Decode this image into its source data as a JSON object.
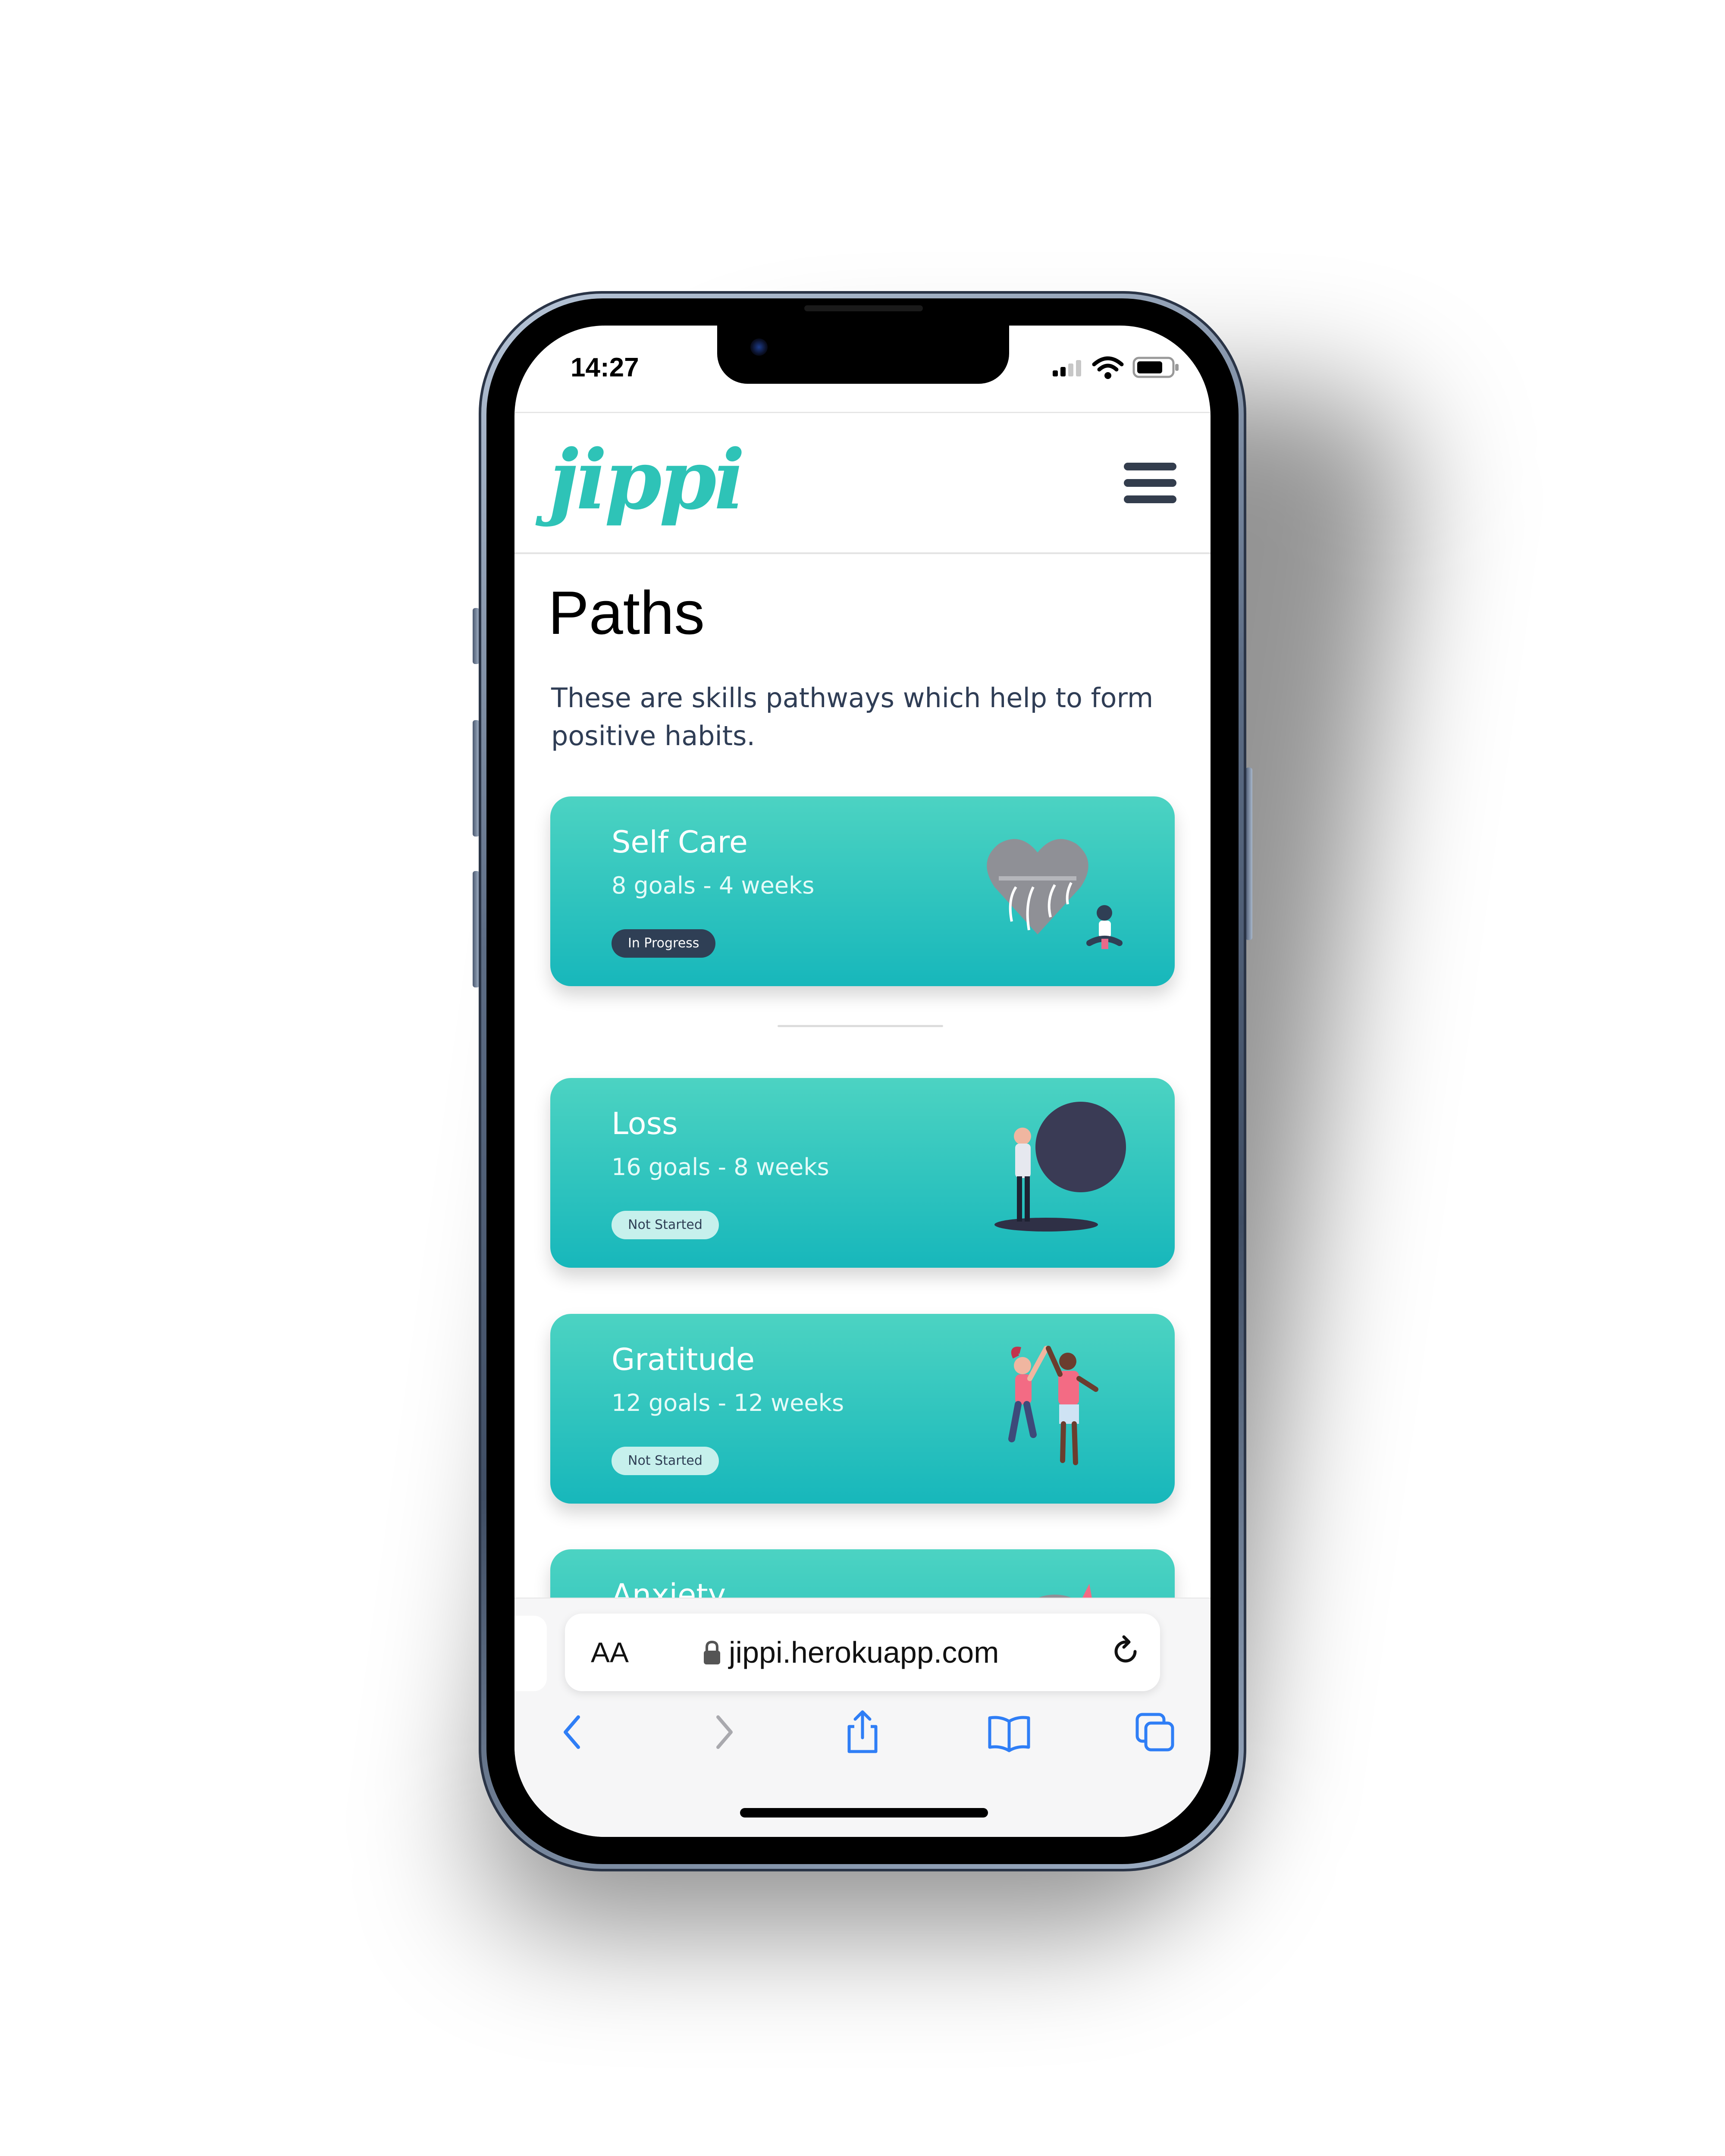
{
  "status_bar": {
    "time": "14:27"
  },
  "header": {
    "logo": "jippi",
    "menu_icon": "hamburger-menu-icon"
  },
  "page": {
    "title": "Paths",
    "description": "These are skills pathways which help to form positive habits."
  },
  "paths": [
    {
      "title": "Self Care",
      "meta": "8 goals - 4 weeks",
      "status": "In Progress"
    },
    {
      "title": "Loss",
      "meta": "16 goals - 8 weeks",
      "status": "Not Started"
    },
    {
      "title": "Gratitude",
      "meta": "12 goals - 12 weeks",
      "status": "Not Started"
    },
    {
      "title": "Anxiety"
    }
  ],
  "browser": {
    "text_size_label": "AA",
    "url": "jippi.herokuapp.com",
    "toolbar_icons": [
      "back-icon",
      "forward-icon",
      "share-icon",
      "bookmarks-icon",
      "tabs-icon"
    ]
  },
  "colors": {
    "brand": "#2ec3b7",
    "card_top": "#4cd3c2",
    "card_bottom": "#17b7bb",
    "text_dark": "#2f3d55",
    "ios_blue": "#2f7ef6"
  }
}
